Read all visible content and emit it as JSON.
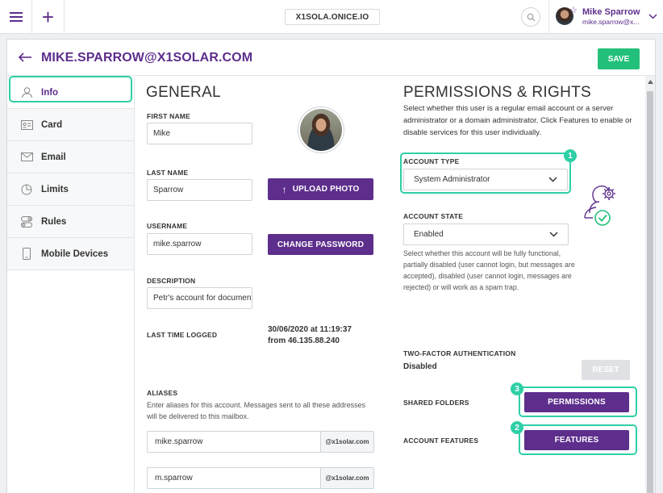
{
  "topbar": {
    "domain": "X1SOLA.ONICE.IO",
    "user_name": "Mike Sparrow",
    "user_email": "mike.sparrow@x..."
  },
  "header": {
    "title": "MIKE.SPARROW@X1SOLAR.COM",
    "save_label": "SAVE"
  },
  "sidebar": {
    "items": [
      {
        "label": "Info",
        "icon": "user-icon"
      },
      {
        "label": "Card",
        "icon": "id-card-icon"
      },
      {
        "label": "Email",
        "icon": "envelope-icon"
      },
      {
        "label": "Limits",
        "icon": "pie-chart-icon"
      },
      {
        "label": "Rules",
        "icon": "toggle-icon"
      },
      {
        "label": "Mobile Devices",
        "icon": "mobile-icon"
      }
    ],
    "active_index": 0
  },
  "general": {
    "title": "GENERAL",
    "first_name_label": "FIRST NAME",
    "first_name": "Mike",
    "last_name_label": "LAST NAME",
    "last_name": "Sparrow",
    "upload_photo_label": "UPLOAD PHOTO",
    "username_label": "USERNAME",
    "username": "mike.sparrow",
    "change_password_label": "CHANGE PASSWORD",
    "description_label": "DESCRIPTION",
    "description": "Petr's account for document",
    "last_logged_label": "LAST TIME LOGGED",
    "last_logged_line1": "30/06/2020 at 11:19:37",
    "last_logged_line2": "from 46.135.88.240",
    "aliases_label": "ALIASES",
    "aliases_desc": "Enter aliases for this account. Messages sent to all these addresses will be delivered to this mailbox.",
    "aliases": [
      {
        "name": "mike.sparrow",
        "domain": "@x1solar.com"
      },
      {
        "name": "m.sparrow",
        "domain": "@x1solar.com"
      }
    ]
  },
  "permissions": {
    "title": "PERMISSIONS & RIGHTS",
    "desc": "Select whether this user is a regular email account or a server administrator or a domain administrator. Click Features to enable or disable services for this user individually.",
    "account_type_label": "ACCOUNT TYPE",
    "account_type": "System Administrator",
    "account_state_label": "ACCOUNT STATE",
    "account_state": "Enabled",
    "state_desc": "Select whether this account will be fully functional, partially disabled (user cannot login, but messages are accepted), disabled (user cannot login, messages are rejected) or will work as a spam trap.",
    "twofa_label": "TWO-FACTOR AUTHENTICATION",
    "twofa_value": "Disabled",
    "reset_label": "RESET",
    "shared_folders_label": "SHARED FOLDERS",
    "permissions_btn": "PERMISSIONS",
    "account_features_label": "ACCOUNT FEATURES",
    "features_btn": "FEATURES"
  },
  "badges": {
    "one": "1",
    "two": "2",
    "three": "3"
  },
  "colors": {
    "brand": "#5d2e8c",
    "save": "#22c07a",
    "highlight": "#2fcfa6"
  }
}
